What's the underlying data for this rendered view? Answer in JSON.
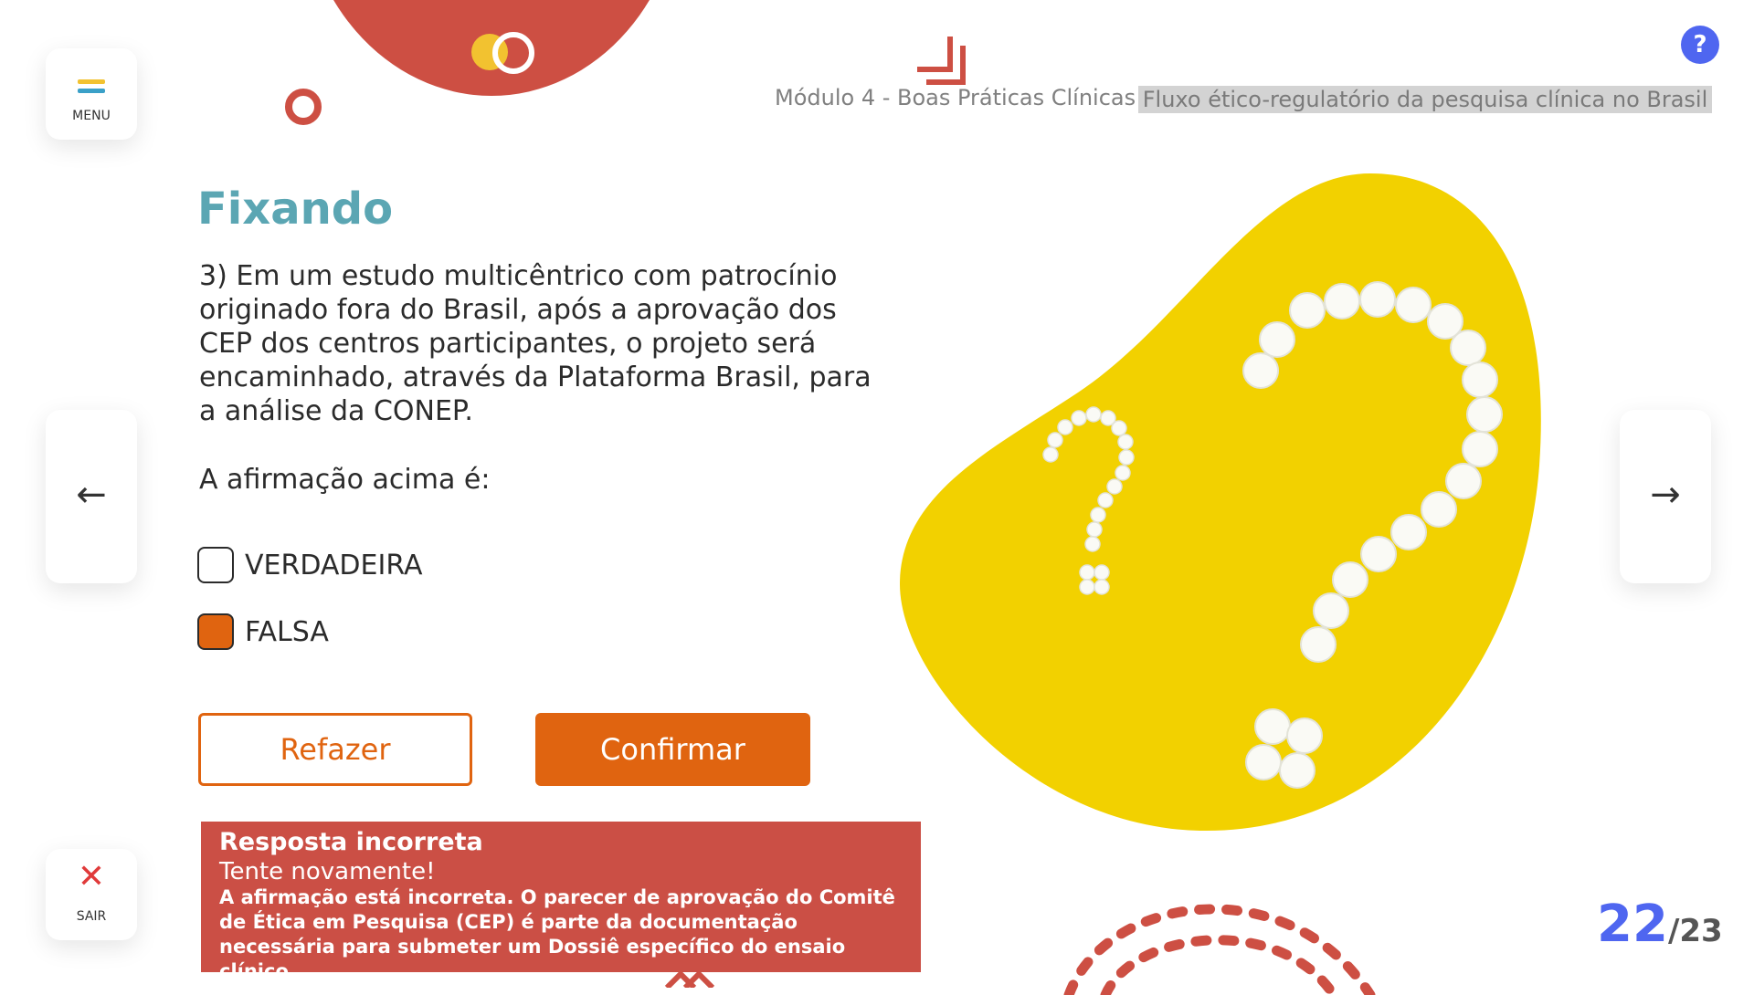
{
  "menu": {
    "label": "MENU",
    "colors": [
      "#f2c230",
      "#3aa0c8"
    ]
  },
  "exit": {
    "label": "SAIR",
    "icon": "close-icon"
  },
  "help": {
    "label": "?"
  },
  "header": {
    "module": "Módulo 4 - Boas Práticas Clínicas",
    "topic": "Fluxo ético-regulatório da pesquisa clínica no Brasil"
  },
  "content": {
    "heading": "Fixando",
    "question": "3) Em um estudo multicêntrico com patrocínio originado fora do Brasil, após a aprovação dos CEP dos centros participantes, o projeto será encaminhado, através da Plataforma Brasil, para a análise da CONEP.",
    "prompt": "A afirmação acima é:",
    "options": [
      {
        "label": "VERDADEIRA",
        "checked": false
      },
      {
        "label": "FALSA",
        "checked": true
      }
    ]
  },
  "buttons": {
    "redo": "Refazer",
    "confirm": "Confirmar"
  },
  "feedback": {
    "title": "Resposta incorreta",
    "subtitle": "Tente novamente!",
    "body": "A afirmação está incorreta. O parecer de aprovação do Comitê de Ética em Pesquisa (CEP) é parte da documentação necessária para submeter um Dossiê específico do ensaio clínico."
  },
  "navigation": {
    "prev_icon": "arrow-left-icon",
    "next_icon": "arrow-right-icon"
  },
  "pagination": {
    "current": "22",
    "total": "/23"
  },
  "colors": {
    "accent": "#e06410",
    "heading": "#5ba6b3",
    "error": "#cb4f45",
    "brand_red": "#cd4f43",
    "page_blue": "#4f66f0",
    "blob_yellow": "#f2d100"
  }
}
